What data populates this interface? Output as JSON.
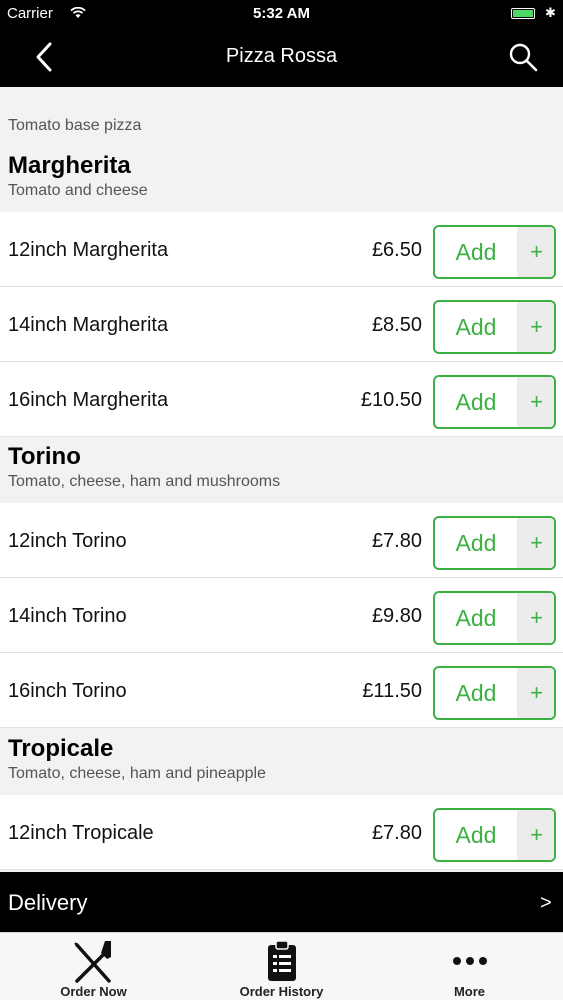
{
  "status_bar": {
    "carrier": "Carrier",
    "time": "5:32 AM"
  },
  "nav": {
    "title": "Pizza Rossa"
  },
  "menu": {
    "category": "Tomato base pizza",
    "sections": [
      {
        "name": "Margherita",
        "description": "Tomato and cheese",
        "items": [
          {
            "name": "12inch Margherita",
            "price": "£6.50",
            "button": "Add",
            "plus": "+"
          },
          {
            "name": "14inch Margherita",
            "price": "£8.50",
            "button": "Add",
            "plus": "+"
          },
          {
            "name": "16inch Margherita",
            "price": "£10.50",
            "button": "Add",
            "plus": "+"
          }
        ]
      },
      {
        "name": "Torino",
        "description": "Tomato, cheese, ham and mushrooms",
        "items": [
          {
            "name": "12inch Torino",
            "price": "£7.80",
            "button": "Add",
            "plus": "+"
          },
          {
            "name": "14inch Torino",
            "price": "£9.80",
            "button": "Add",
            "plus": "+"
          },
          {
            "name": "16inch Torino",
            "price": "£11.50",
            "button": "Add",
            "plus": "+"
          }
        ]
      },
      {
        "name": "Tropicale",
        "description": "Tomato, cheese, ham and pineapple",
        "items": [
          {
            "name": "12inch Tropicale",
            "price": "£7.80",
            "button": "Add",
            "plus": "+"
          }
        ]
      }
    ]
  },
  "delivery": {
    "label": "Delivery",
    "chevron": ">"
  },
  "tabs": [
    {
      "label": "Order Now",
      "icon": "fork-knife-icon"
    },
    {
      "label": "Order History",
      "icon": "clipboard-list-icon"
    },
    {
      "label": "More",
      "icon": "more-dots-icon"
    }
  ],
  "colors": {
    "accent": "#3cb043",
    "bar": "#000000",
    "battery": "#4cd964"
  }
}
